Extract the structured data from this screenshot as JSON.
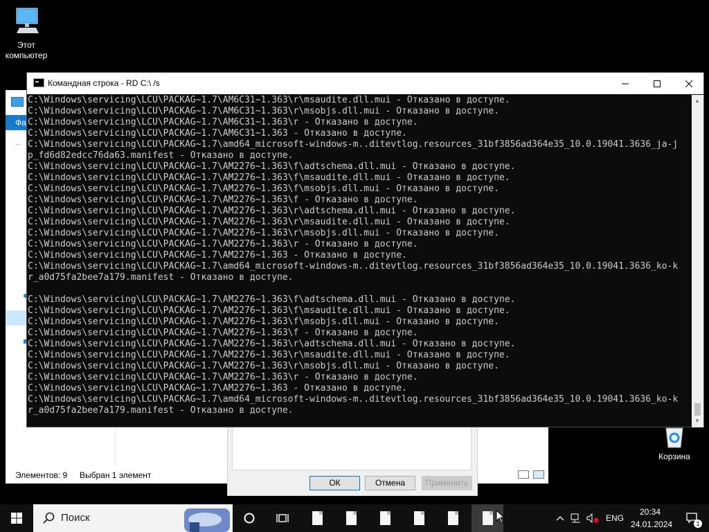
{
  "desktop": {
    "this_pc": {
      "label_line1": "Этот",
      "label_line2": "компьютер",
      "icon": "monitor-icon"
    },
    "recycle_bin": {
      "label": "Корзина",
      "icon": "recycle-bin-icon"
    }
  },
  "explorer": {
    "ribbon_tab": "Фа",
    "status_items": "Элементов: 9",
    "status_selected": "Выбран 1 элемент"
  },
  "properties_dialog": {
    "ok": "ОК",
    "cancel": "Отмена",
    "apply": "Применить"
  },
  "cmd": {
    "title": "Командная строка - RD  C:\\ /s",
    "lines": [
      "C:\\Windows\\servicing\\LCU\\PACKAG~1.7\\AM6C31~1.363\\r\\msaudite.dll.mui - Отказано в доступе.",
      "C:\\Windows\\servicing\\LCU\\PACKAG~1.7\\AM6C31~1.363\\r\\msobjs.dll.mui - Отказано в доступе.",
      "C:\\Windows\\servicing\\LCU\\PACKAG~1.7\\AM6C31~1.363\\r - Отказано в доступе.",
      "C:\\Windows\\servicing\\LCU\\PACKAG~1.7\\AM6C31~1.363 - Отказано в доступе.",
      "C:\\Windows\\servicing\\LCU\\PACKAG~1.7\\amd64_microsoft-windows-m..ditevtlog.resources_31bf3856ad364e35_10.0.19041.3636_ja-j",
      "p_fd6d82edcc76da63.manifest - Отказано в доступе.",
      "C:\\Windows\\servicing\\LCU\\PACKAG~1.7\\AM2276~1.363\\f\\adtschema.dll.mui - Отказано в доступе.",
      "C:\\Windows\\servicing\\LCU\\PACKAG~1.7\\AM2276~1.363\\f\\msaudite.dll.mui - Отказано в доступе.",
      "C:\\Windows\\servicing\\LCU\\PACKAG~1.7\\AM2276~1.363\\f\\msobjs.dll.mui - Отказано в доступе.",
      "C:\\Windows\\servicing\\LCU\\PACKAG~1.7\\AM2276~1.363\\f - Отказано в доступе.",
      "C:\\Windows\\servicing\\LCU\\PACKAG~1.7\\AM2276~1.363\\r\\adtschema.dll.mui - Отказано в доступе.",
      "C:\\Windows\\servicing\\LCU\\PACKAG~1.7\\AM2276~1.363\\r\\msaudite.dll.mui - Отказано в доступе.",
      "C:\\Windows\\servicing\\LCU\\PACKAG~1.7\\AM2276~1.363\\r\\msobjs.dll.mui - Отказано в доступе.",
      "C:\\Windows\\servicing\\LCU\\PACKAG~1.7\\AM2276~1.363\\r - Отказано в доступе.",
      "C:\\Windows\\servicing\\LCU\\PACKAG~1.7\\AM2276~1.363 - Отказано в доступе.",
      "C:\\Windows\\servicing\\LCU\\PACKAG~1.7\\amd64_microsoft-windows-m..ditevtlog.resources_31bf3856ad364e35_10.0.19041.3636_ko-k",
      "r_a0d75fa2bee7a179.manifest - Отказано в доступе.",
      "",
      "C:\\Windows\\servicing\\LCU\\PACKAG~1.7\\AM2276~1.363\\f\\adtschema.dll.mui - Отказано в доступе.",
      "C:\\Windows\\servicing\\LCU\\PACKAG~1.7\\AM2276~1.363\\f\\msaudite.dll.mui - Отказано в доступе.",
      "C:\\Windows\\servicing\\LCU\\PACKAG~1.7\\AM2276~1.363\\f\\msobjs.dll.mui - Отказано в доступе.",
      "C:\\Windows\\servicing\\LCU\\PACKAG~1.7\\AM2276~1.363\\f - Отказано в доступе.",
      "C:\\Windows\\servicing\\LCU\\PACKAG~1.7\\AM2276~1.363\\r\\adtschema.dll.mui - Отказано в доступе.",
      "C:\\Windows\\servicing\\LCU\\PACKAG~1.7\\AM2276~1.363\\r\\msaudite.dll.mui - Отказано в доступе.",
      "C:\\Windows\\servicing\\LCU\\PACKAG~1.7\\AM2276~1.363\\r\\msobjs.dll.mui - Отказано в доступе.",
      "C:\\Windows\\servicing\\LCU\\PACKAG~1.7\\AM2276~1.363\\r - Отказано в доступе.",
      "C:\\Windows\\servicing\\LCU\\PACKAG~1.7\\AM2276~1.363 - Отказано в доступе.",
      "C:\\Windows\\servicing\\LCU\\PACKAG~1.7\\amd64_microsoft-windows-m..ditevtlog.resources_31bf3856ad364e35_10.0.19041.3636_ko-k",
      "r_a0d75fa2bee7a179.manifest - Отказано в доступе."
    ]
  },
  "taskbar": {
    "search_label": "Поиск",
    "language": "ENG",
    "time": "20:34",
    "date": "24.01.2024",
    "notification_count": "1",
    "accent": "#0078d7"
  }
}
